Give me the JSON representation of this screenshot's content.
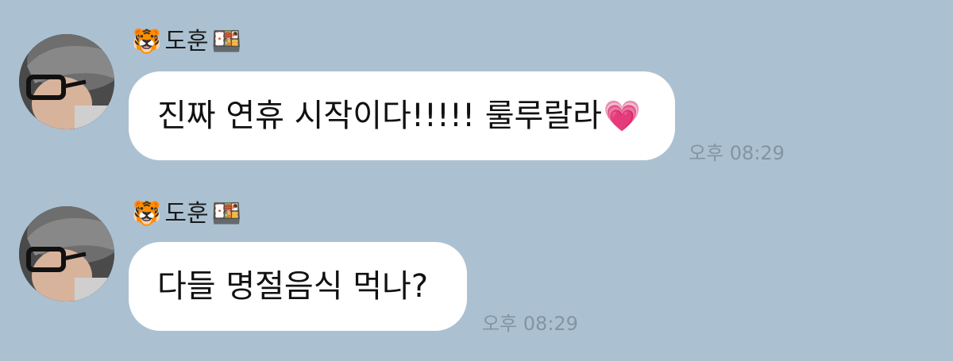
{
  "messages": [
    {
      "sender": {
        "prefix_emoji": "🐯",
        "name": "도훈",
        "suffix_emoji": "🍱"
      },
      "text": "진짜 연휴 시작이다!!!!! 룰루랄라",
      "emoji": "💗",
      "time": "오후 08:29"
    },
    {
      "sender": {
        "prefix_emoji": "🐯",
        "name": "도훈",
        "suffix_emoji": "🍱"
      },
      "text": "다들 명절음식 먹나?",
      "emoji": "",
      "time": "오후 08:29"
    }
  ],
  "colors": {
    "background": "#abc1d1",
    "bubble": "#ffffff",
    "time_text": "#8493a2",
    "heart": "#e0369e"
  },
  "icons": {
    "avatar": "profile-avatar-photo"
  }
}
